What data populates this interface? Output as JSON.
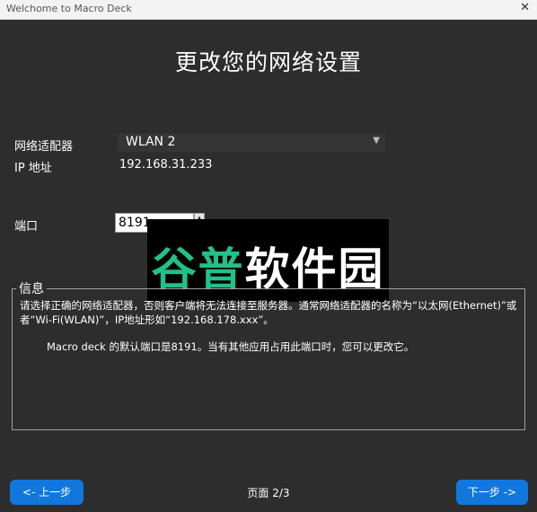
{
  "window": {
    "title": "Welchome to Macro Deck",
    "close_glyph": "✕"
  },
  "page": {
    "heading": "更改您的网络设置"
  },
  "network": {
    "adapter_label": "网络适配器",
    "adapter_value": "WLAN 2",
    "ip_label": "IP 地址",
    "ip_value": "192.168.31.233",
    "port_label": "端口",
    "port_value": "8191"
  },
  "watermark": {
    "text": "谷普软件园"
  },
  "info": {
    "legend": "信息",
    "paragraph1": "请选择正确的网络适配器，否则客户端将无法连接至服务器。通常网络适配器的名称为“以太网(Ethernet)”或者“Wi-Fi(WLAN)”，IP地址形如“192.168.178.xxx”。",
    "paragraph2": "Macro deck 的默认端口是8191。当有其他应用占用此端口时，您可以更改它。"
  },
  "nav": {
    "back_label": "<- 上一步",
    "page_indicator": "页面 2/3",
    "next_label": "下一步 ->"
  },
  "colors": {
    "background": "#2d2d2d",
    "accent_button": "#1177dd",
    "watermark_green": "#22c08a"
  }
}
